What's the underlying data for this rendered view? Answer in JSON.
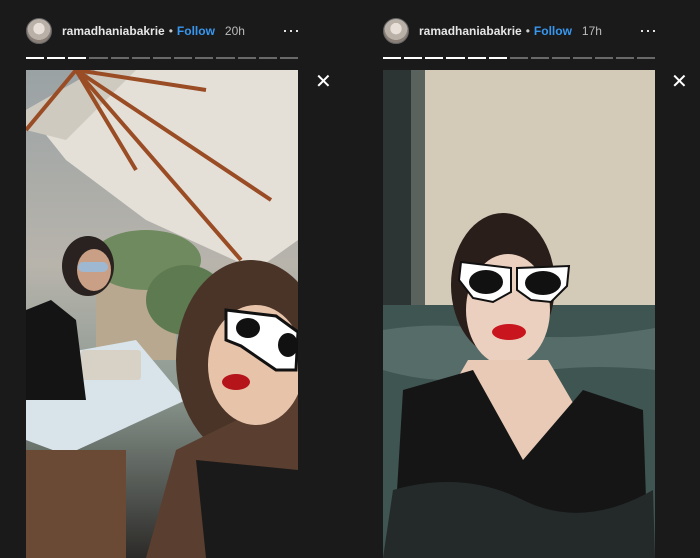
{
  "stories": [
    {
      "username": "ramadhaniabakrie",
      "separator": "•",
      "follow_label": "Follow",
      "time": "20h",
      "more_icon": "⋯",
      "close_icon": "✕",
      "progress": {
        "segments": 13,
        "completed": 3
      }
    },
    {
      "username": "ramadhaniabakrie",
      "separator": "•",
      "follow_label": "Follow",
      "time": "17h",
      "more_icon": "⋯",
      "close_icon": "✕",
      "progress": {
        "segments": 13,
        "completed": 6
      }
    }
  ]
}
